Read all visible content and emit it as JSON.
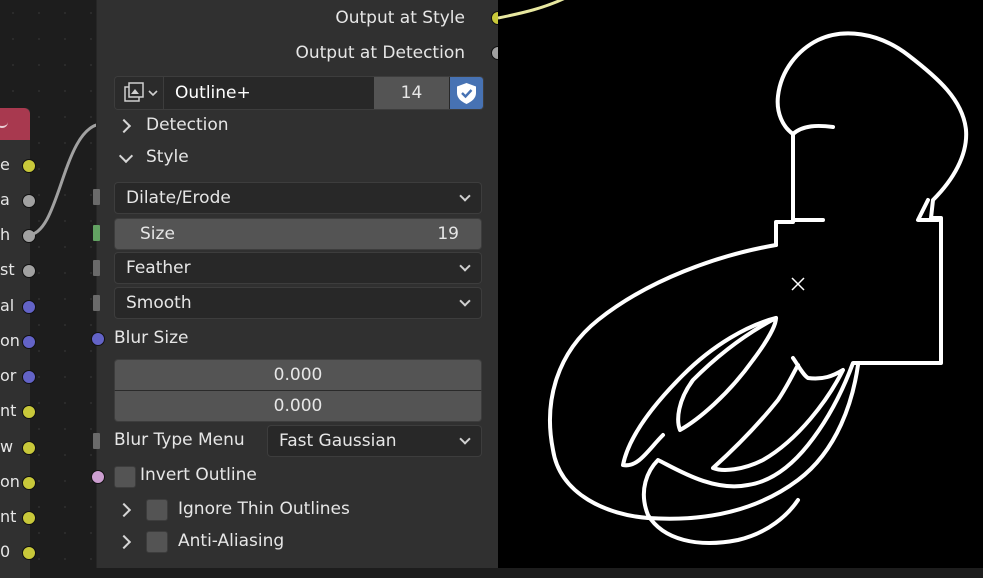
{
  "left_node": {
    "sockets": [
      {
        "label": "e",
        "color": "#c8c83a"
      },
      {
        "label": "a",
        "color": "#a1a1a1"
      },
      {
        "label": "h",
        "color": "#a1a1a1"
      },
      {
        "label": "st",
        "color": "#a1a1a1"
      },
      {
        "label": "al",
        "color": "#6363c7"
      },
      {
        "label": "on",
        "color": "#6363c7"
      },
      {
        "label": "or",
        "color": "#6363c7"
      },
      {
        "label": "nt",
        "color": "#c8c83a"
      },
      {
        "label": "w",
        "color": "#c8c83a"
      },
      {
        "label": "on",
        "color": "#c8c83a"
      },
      {
        "label": "nt",
        "color": "#c8c83a"
      },
      {
        "label": "0",
        "color": "#c8c83a"
      }
    ]
  },
  "node": {
    "outputs": [
      {
        "label": "Output at Style",
        "color": "#c8c83a"
      },
      {
        "label": "Output at Detection",
        "color": "#a1a1a1"
      }
    ],
    "data_block": {
      "name": "Outline+",
      "users": "14"
    },
    "panels": {
      "detection": "Detection",
      "style": "Style"
    },
    "style": {
      "mode_dropdown": "Dilate/Erode",
      "size_label": "Size",
      "size_value": "19",
      "feather_dropdown": "Feather",
      "smooth_dropdown": "Smooth",
      "blur_size_label": "Blur Size",
      "blur_size_x": "0.000",
      "blur_size_y": "0.000",
      "blur_type_label": "Blur Type Menu",
      "blur_type_value": "Fast Gaussian",
      "invert_outline": "Invert Outline",
      "ignore_thin": "Ignore Thin Outlines",
      "anti_aliasing": "Anti-Aliasing"
    }
  },
  "colors": {
    "node_bg": "#303030",
    "accent_blue": "#4772b3",
    "socket_yellow": "#c8c83a",
    "socket_gray": "#a1a1a1",
    "socket_blue": "#6363c7",
    "socket_pink": "#cc9ed0"
  }
}
